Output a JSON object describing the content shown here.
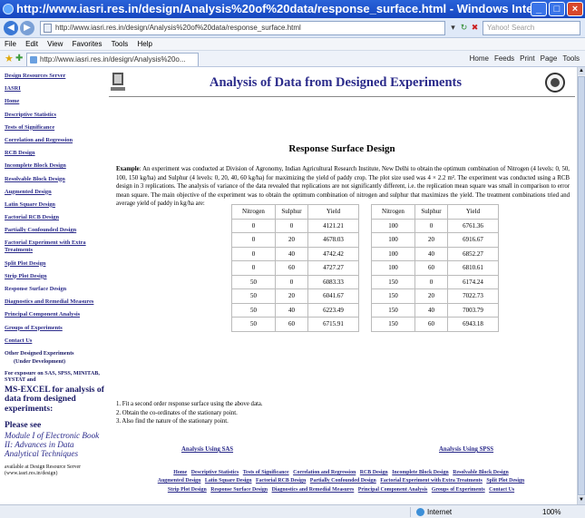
{
  "window": {
    "title": "http://www.iasri.res.in/design/Analysis%20of%20data/response_surface.html - Windows Internet Explorer",
    "minimize": "_",
    "maximize": "□",
    "close": "×"
  },
  "address": {
    "url": "http://www.iasri.res.in/design/Analysis%20of%20data/response_surface.html",
    "search_placeholder": "Yahoo! Search"
  },
  "menu": [
    "File",
    "Edit",
    "View",
    "Favorites",
    "Tools",
    "Help"
  ],
  "tab": {
    "label": "http://www.iasri.res.in/design/Analysis%20o..."
  },
  "commands": [
    "Home",
    "Feeds",
    "Print",
    "Page",
    "Tools"
  ],
  "sidebar": {
    "items": [
      "Design Resources Server",
      "IASRI",
      "Home",
      "Descriptive Statistics",
      "Tests of Significance",
      "Correlation and Regression",
      "RCB Design",
      "Incomplete Block Design",
      "Resolvable Block Design",
      "Augmented Design",
      "Latin Square Design",
      "Factorial RCB Design",
      "Partially Confounded Design",
      "Factorial Experiment with Extra Treatments",
      "Split Plot Design",
      "Strip Plot Design",
      "Response Surface Design",
      "Diagnostics and Remedial Measures",
      "Principal Component Analysis",
      "Groups of Experiments",
      "Contact Us"
    ],
    "other_designed": "Other Designed Experiments",
    "under_dev": "(Under Development)",
    "exposure": "For exposure on SAS, SPSS, MINITAB, SYSTAT and",
    "msexcel": "MS-EXCEL for analysis of data from designed experiments:",
    "please_see": "Please see",
    "module": "Module I of Electronic Book II: Advances in Data Analytical Techniques",
    "available": "available at Design Resource Server (www.iasri.res.in/design)"
  },
  "main": {
    "title": "Analysis of Data from Designed Experiments",
    "section_title": "Response Surface Design",
    "example_label": "Example",
    "paragraph": ": An experiment was conducted at Division of Agronomy, Indian Agricultural Research Institute, New Delhi to obtain the optimum combination of Nitrogen (4 levels: 0, 50, 100, 150 kg/ha) and Sulphur (4 levels: 0, 20, 40, 60 kg/ha) for maximizing the yield of paddy crop. The plot size used was 4 × 2.2 m². The experiment was conducted using a RCB design in 3 replications. The analysis of variance of the data revealed that replications are not significantly different, i.e. the replication mean square was small in comparison to error mean square. The main objective of the experiment was to obtain the optimum combination of nitrogen and sulphur that maximizes the yield. The treatment combinations tried and average yield of paddy in kg/ha are:",
    "table": {
      "headers": [
        "Nitrogen",
        "Sulphur",
        "Yield",
        "Nitrogen",
        "Sulphur",
        "Yield"
      ],
      "rows": [
        [
          "0",
          "0",
          "4121.21",
          "100",
          "0",
          "6761.36"
        ],
        [
          "0",
          "20",
          "4678.03",
          "100",
          "20",
          "6916.67"
        ],
        [
          "0",
          "40",
          "4742.42",
          "100",
          "40",
          "6852.27"
        ],
        [
          "0",
          "60",
          "4727.27",
          "100",
          "60",
          "6810.61"
        ],
        [
          "50",
          "0",
          "6083.33",
          "150",
          "0",
          "6174.24"
        ],
        [
          "50",
          "20",
          "6041.67",
          "150",
          "20",
          "7022.73"
        ],
        [
          "50",
          "40",
          "6223.49",
          "150",
          "40",
          "7003.79"
        ],
        [
          "50",
          "60",
          "6715.91",
          "150",
          "60",
          "6943.18"
        ]
      ]
    },
    "questions": [
      "1. Fit a second order response surface using the above data.",
      "2. Obtain the co-ordinates of the stationary point.",
      "3. Also find the nature of the stationary point."
    ],
    "link_sas": "Analysis Using SAS",
    "link_spss": "Analysis Using SPSS",
    "footer_lines": [
      [
        "Home",
        "Descriptive Statistics",
        "Tests of Significance",
        "Correlation and Regression",
        "RCB Design",
        "Incomplete Block Design",
        "Resolvable Block Design"
      ],
      [
        "Augmented Design",
        "Latin Square Design",
        "Factorial RCB Design",
        "Partially Confounded Design",
        "Factorial Experiment with Extra Treatments",
        "Split Plot Design"
      ],
      [
        "Strip Plot Design",
        "Response Surface Design",
        "Diagnostics and Remedial Measures",
        "Principal Component Analysis",
        "Groups of Experiments",
        "Contact Us"
      ]
    ]
  },
  "status": {
    "zone": "Internet",
    "zoom": "100%"
  }
}
